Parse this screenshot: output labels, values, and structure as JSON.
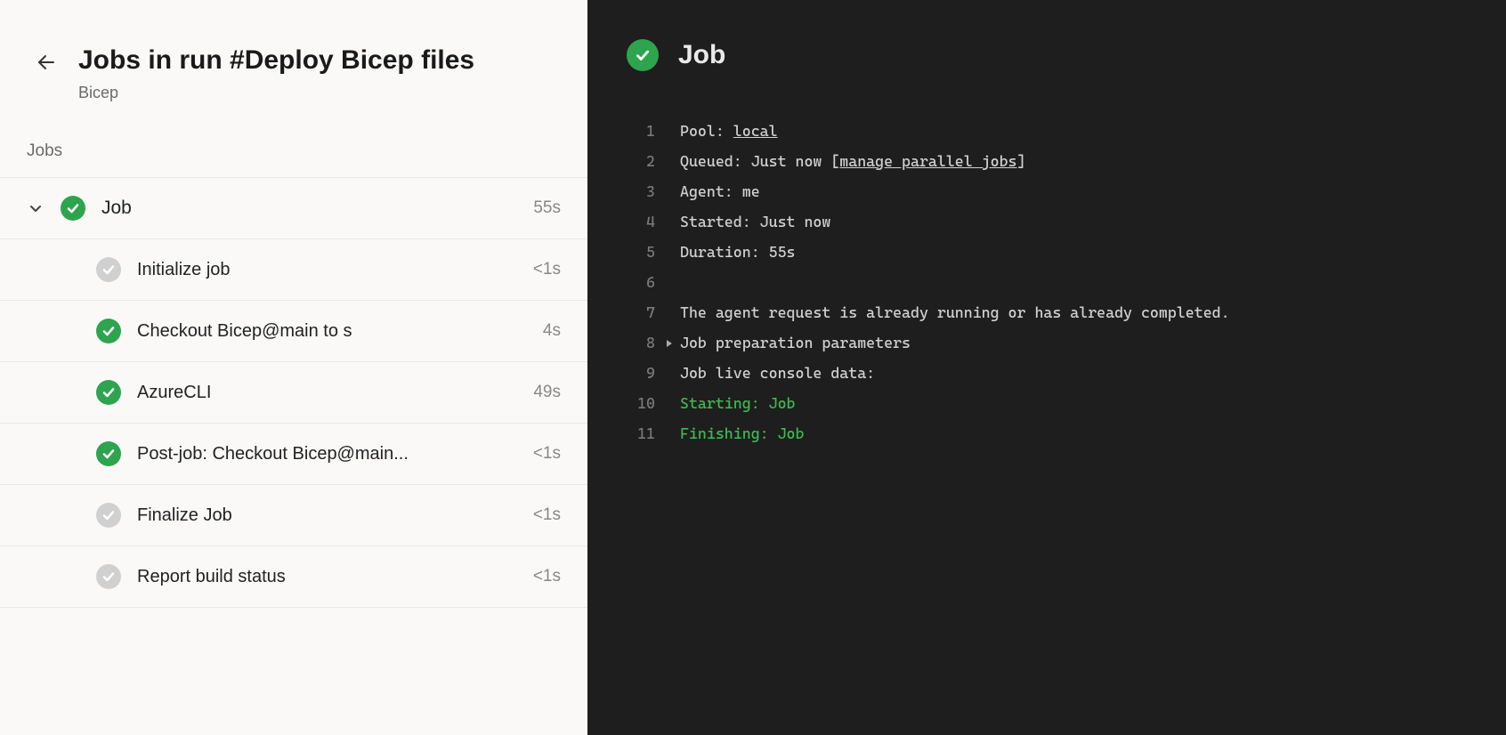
{
  "header": {
    "title": "Jobs in run #Deploy Bicep files",
    "subtitle": "Bicep"
  },
  "sectionLabel": "Jobs",
  "job": {
    "name": "Job",
    "duration": "55s",
    "status": "success",
    "steps": [
      {
        "name": "Initialize job",
        "duration": "<1s",
        "status": "neutral"
      },
      {
        "name": "Checkout Bicep@main to s",
        "duration": "4s",
        "status": "success"
      },
      {
        "name": "AzureCLI",
        "duration": "49s",
        "status": "success"
      },
      {
        "name": "Post-job: Checkout Bicep@main...",
        "duration": "<1s",
        "status": "success"
      },
      {
        "name": "Finalize Job",
        "duration": "<1s",
        "status": "neutral"
      },
      {
        "name": "Report build status",
        "duration": "<1s",
        "status": "neutral"
      }
    ]
  },
  "detail": {
    "title": "Job",
    "status": "success",
    "lines": [
      {
        "n": 1,
        "segments": [
          {
            "t": "Pool: "
          },
          {
            "t": "local",
            "link": true
          }
        ]
      },
      {
        "n": 2,
        "segments": [
          {
            "t": "Queued: Just now ["
          },
          {
            "t": "manage parallel jobs",
            "link": true
          },
          {
            "t": "]"
          }
        ]
      },
      {
        "n": 3,
        "segments": [
          {
            "t": "Agent: me"
          }
        ]
      },
      {
        "n": 4,
        "segments": [
          {
            "t": "Started: Just now"
          }
        ]
      },
      {
        "n": 5,
        "segments": [
          {
            "t": "Duration: 55s"
          }
        ]
      },
      {
        "n": 6,
        "segments": [
          {
            "t": ""
          }
        ]
      },
      {
        "n": 7,
        "segments": [
          {
            "t": "The agent request is already running or has already completed."
          }
        ]
      },
      {
        "n": 8,
        "expand": true,
        "segments": [
          {
            "t": "Job preparation parameters"
          }
        ]
      },
      {
        "n": 9,
        "segments": [
          {
            "t": "Job live console data:"
          }
        ]
      },
      {
        "n": 10,
        "segments": [
          {
            "t": "Starting: Job",
            "class": "green"
          }
        ]
      },
      {
        "n": 11,
        "segments": [
          {
            "t": "Finishing: Job",
            "class": "green"
          }
        ]
      }
    ]
  }
}
